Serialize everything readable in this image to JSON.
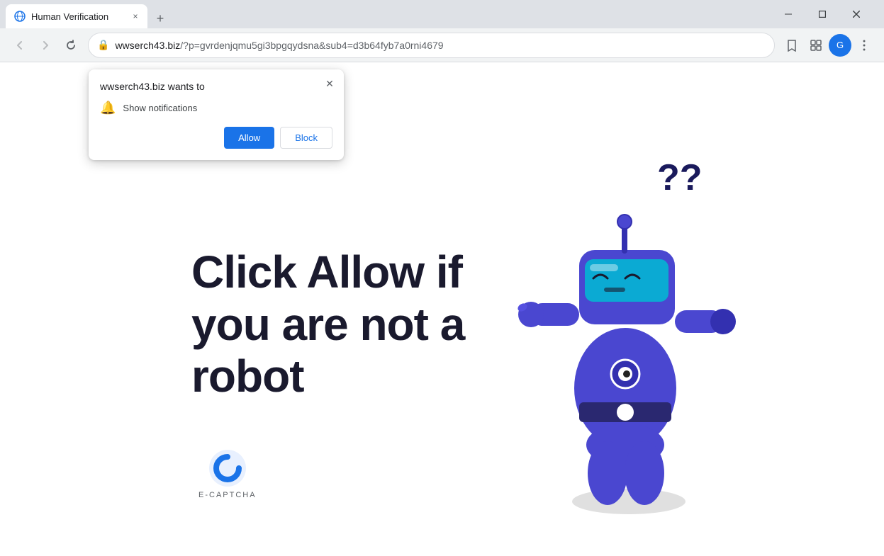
{
  "browser": {
    "tab": {
      "title": "Human Verification",
      "close_label": "×"
    },
    "new_tab_label": "+",
    "toolbar": {
      "url": "wwserch43.biz/?p=gvrdenjqmu5gi3bpgqydsna&sub4=d3b64fyb7a0rni4679",
      "url_domain": "wwserch43.biz",
      "url_path": "/?p=gvrdenjqmu5gi3bpgqydsna&sub4=d3b64fyb7a0rni4679"
    },
    "window_controls": {
      "minimize": "—",
      "maximize": "□",
      "close": "✕"
    }
  },
  "notification_popup": {
    "title": "wwserch43.biz wants to",
    "permission": "Show notifications",
    "close_label": "✕",
    "allow_label": "Allow",
    "block_label": "Block"
  },
  "page": {
    "heading_line1": "Click Allow if",
    "heading_line2": "you are not a",
    "heading_line3": "robot",
    "captcha_label": "E-CAPTCHA"
  }
}
